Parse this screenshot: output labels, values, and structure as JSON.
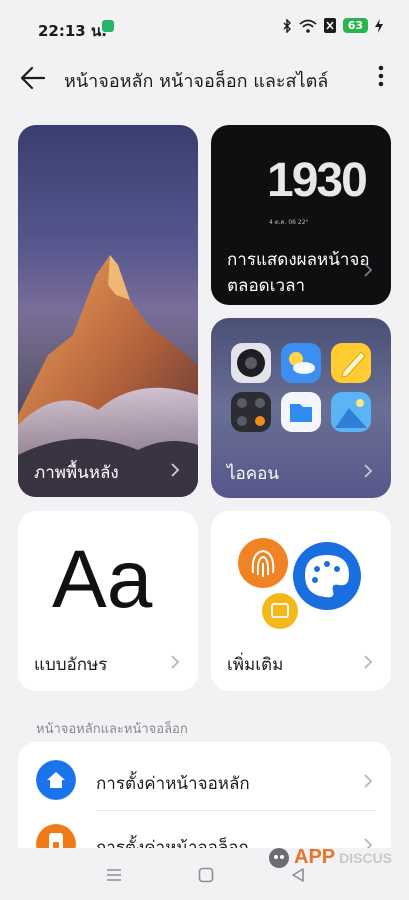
{
  "status": {
    "time": "22:13 น.",
    "battery": "63"
  },
  "header": {
    "title": "หน้าจอหลัก หน้าจอล็อก และสไตล์"
  },
  "cards": {
    "wallpaper_label": "ภาพพื้นหลัง",
    "aod_time": "1930",
    "aod_date": "4 ต.ค. 06  22°",
    "aod_label": "การแสดงผลหน้าจอตลอดเวลา",
    "icons_label": "ไอคอน",
    "fonts_sample": "Aa",
    "fonts_label": "แบบอักษร",
    "more_label": "เพิ่มเติม"
  },
  "section": {
    "title": "หน้าจอหลักและหน้าจอล็อก",
    "items": [
      {
        "label": "การตั้งค่าหน้าจอหลัก",
        "icon": "home-icon",
        "color": "#1a73e8"
      },
      {
        "label": "การตั้งค่าหน้าจอล็อก",
        "icon": "lock-screen-icon",
        "color": "#f07a1a"
      }
    ]
  },
  "watermark": {
    "brand": "APP",
    "sub": "DISCUS"
  }
}
